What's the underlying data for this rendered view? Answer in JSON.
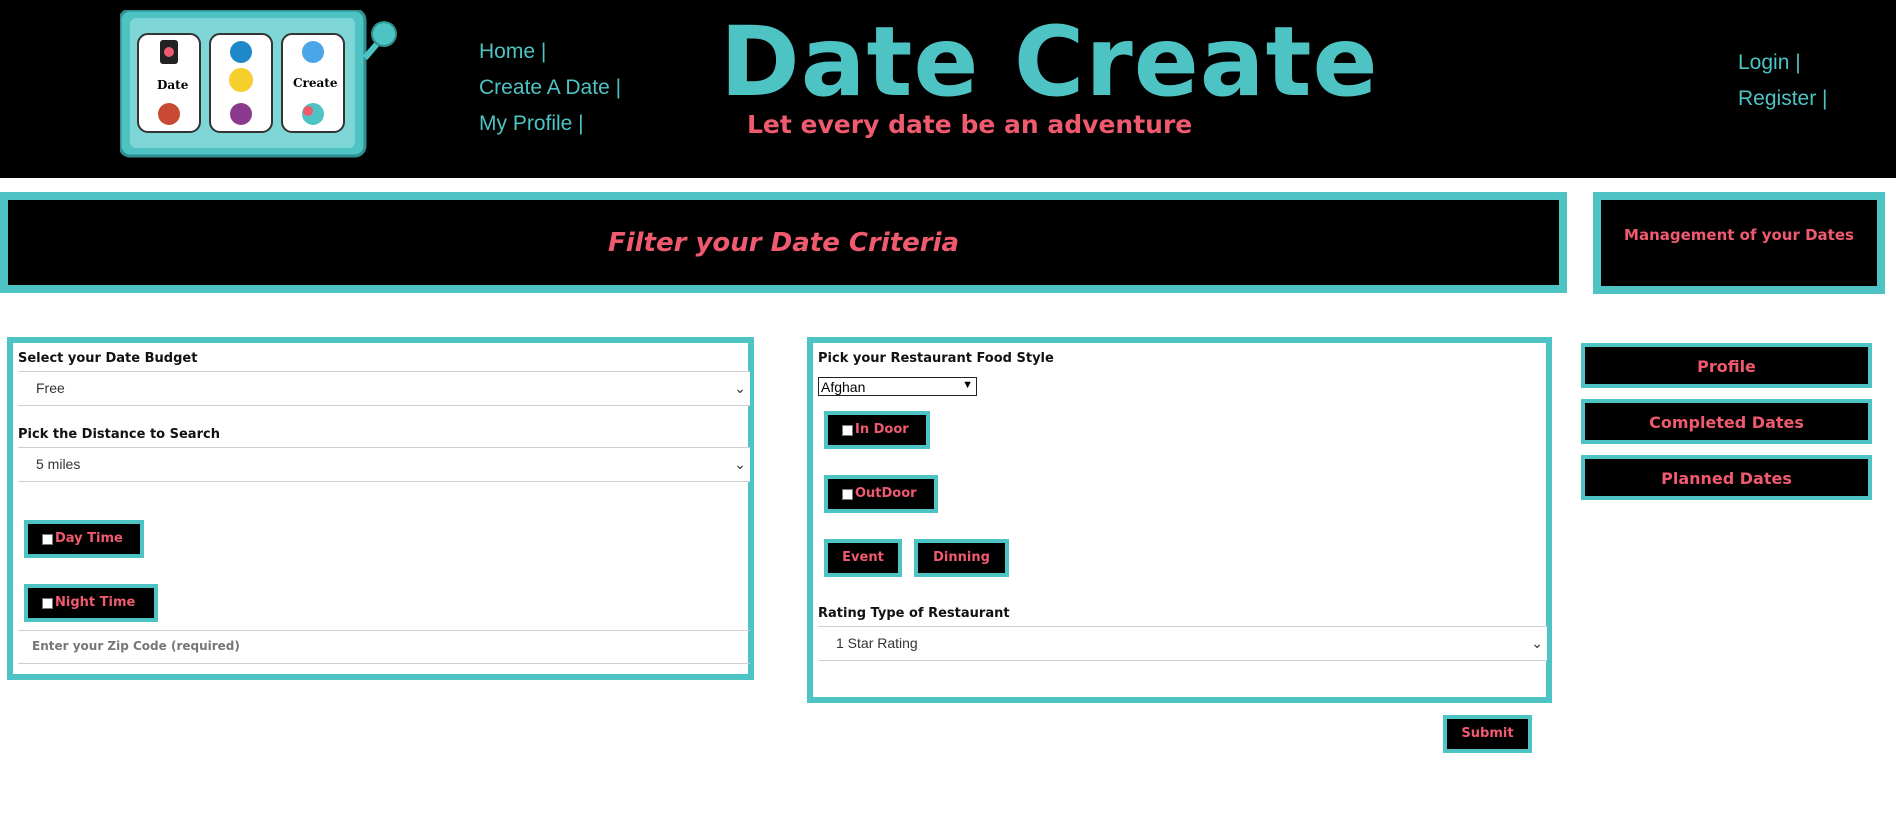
{
  "header": {
    "brand_title": "Date Create",
    "tagline": "Let every date be an adventure",
    "logo_reel_labels": [
      "Date",
      "Create"
    ],
    "nav_left": [
      "Home |",
      "Create A Date |",
      "My Profile |"
    ],
    "nav_right": [
      "Login |",
      "Register |"
    ]
  },
  "banner": {
    "title": "Filter your Date Criteria"
  },
  "management": {
    "title": "Management of your Dates"
  },
  "left_panel": {
    "budget_label": "Select your Date Budget",
    "budget_value": "Free",
    "distance_label": "Pick the Distance to Search",
    "distance_value": "5 miles",
    "day_time": "Day Time",
    "night_time": "Night Time",
    "zip_placeholder": "Enter your Zip Code (required)"
  },
  "right_panel": {
    "food_label": "Pick your Restaurant Food Style",
    "food_value": "Afghan",
    "in_door": "In Door",
    "out_door": "OutDoor",
    "event": "Event",
    "dinning": "Dinning",
    "rating_label": "Rating Type of Restaurant",
    "rating_value": "1 Star Rating"
  },
  "sidebar": {
    "buttons": [
      "Profile",
      "Completed Dates",
      "Planned Dates"
    ]
  },
  "submit_label": "Submit",
  "colors": {
    "accent": "#4ec3c3",
    "highlight": "#ef5a6f",
    "background": "#000000"
  }
}
